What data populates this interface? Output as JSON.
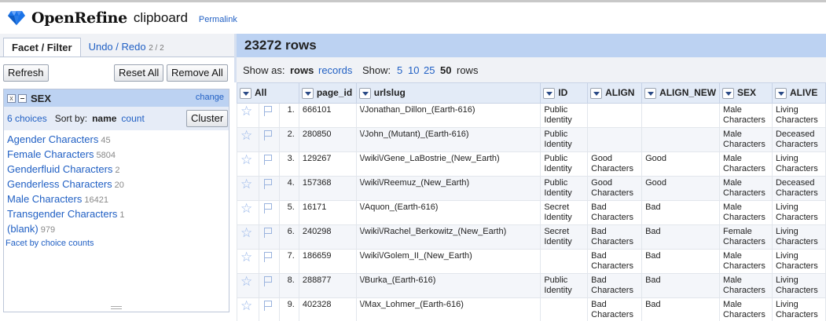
{
  "app": {
    "brand": "OpenRefine",
    "project_name": "clipboard",
    "permalink_label": "Permalink"
  },
  "left_panel": {
    "tabs": [
      {
        "label": "Facet / Filter",
        "sub": ""
      },
      {
        "label": "Undo / Redo",
        "sub": "2 / 2"
      }
    ],
    "refresh_label": "Refresh",
    "reset_all_label": "Reset All",
    "remove_all_label": "Remove All"
  },
  "facet": {
    "remove_glyph": "x",
    "name": "SEX",
    "change_label": "change",
    "choices_label": "6 choices",
    "sort_by_label": "Sort by:",
    "sort_name_label": "name",
    "sort_count_label": "count",
    "cluster_label": "Cluster",
    "choices": [
      {
        "label": "Agender Characters",
        "count": "45"
      },
      {
        "label": "Female Characters",
        "count": "5804"
      },
      {
        "label": "Genderfluid Characters",
        "count": "2"
      },
      {
        "label": "Genderless Characters",
        "count": "20"
      },
      {
        "label": "Male Characters",
        "count": "16421"
      },
      {
        "label": "Transgender Characters",
        "count": "1"
      },
      {
        "label": "(blank)",
        "count": "979"
      }
    ],
    "footer_link": "Facet by choice counts"
  },
  "main": {
    "row_count_title": "23272 rows",
    "show_as_label": "Show as:",
    "show_as_rows": "rows",
    "show_as_records": "records",
    "show_label": "Show:",
    "page_sizes": [
      "5",
      "10",
      "25",
      "50"
    ],
    "selected_page_size": "50",
    "rows_word": "rows"
  },
  "table": {
    "columns": [
      {
        "key": "all",
        "label": "All"
      },
      {
        "key": "page_id",
        "label": "page_id"
      },
      {
        "key": "urlslug",
        "label": "urlslug"
      },
      {
        "key": "ID",
        "label": "ID"
      },
      {
        "key": "ALIGN",
        "label": "ALIGN"
      },
      {
        "key": "ALIGN_NEW",
        "label": "ALIGN_NEW"
      },
      {
        "key": "SEX",
        "label": "SEX"
      },
      {
        "key": "ALIVE",
        "label": "ALIVE"
      }
    ],
    "rows": [
      {
        "n": "1.",
        "page_id": "666101",
        "urlslug": "\\/Jonathan_Dillon_(Earth-616)",
        "id1": "Public",
        "id2": "Identity",
        "al1": "",
        "al2": "",
        "aln": "",
        "sx1": "Male",
        "sx2": "Characters",
        "lv1": "Living",
        "lv2": "Characters"
      },
      {
        "n": "2.",
        "page_id": "280850",
        "urlslug": "\\/John_(Mutant)_(Earth-616)",
        "id1": "Public",
        "id2": "Identity",
        "al1": "",
        "al2": "",
        "aln": "",
        "sx1": "Male",
        "sx2": "Characters",
        "lv1": "Deceased",
        "lv2": "Characters"
      },
      {
        "n": "3.",
        "page_id": "129267",
        "urlslug": "\\/wiki\\/Gene_LaBostrie_(New_Earth)",
        "id1": "Public",
        "id2": "Identity",
        "al1": "Good",
        "al2": "Characters",
        "aln": "Good",
        "sx1": "Male",
        "sx2": "Characters",
        "lv1": "Living",
        "lv2": "Characters"
      },
      {
        "n": "4.",
        "page_id": "157368",
        "urlslug": "\\/wiki\\/Reemuz_(New_Earth)",
        "id1": "Public",
        "id2": "Identity",
        "al1": "Good",
        "al2": "Characters",
        "aln": "Good",
        "sx1": "Male",
        "sx2": "Characters",
        "lv1": "Deceased",
        "lv2": "Characters"
      },
      {
        "n": "5.",
        "page_id": "16171",
        "urlslug": "\\/Aquon_(Earth-616)",
        "id1": "Secret",
        "id2": "Identity",
        "al1": "Bad",
        "al2": "Characters",
        "aln": "Bad",
        "sx1": "Male",
        "sx2": "Characters",
        "lv1": "Living",
        "lv2": "Characters"
      },
      {
        "n": "6.",
        "page_id": "240298",
        "urlslug": "\\/wiki\\/Rachel_Berkowitz_(New_Earth)",
        "id1": "Secret",
        "id2": "Identity",
        "al1": "Bad",
        "al2": "Characters",
        "aln": "Bad",
        "sx1": "Female",
        "sx2": "Characters",
        "lv1": "Living",
        "lv2": "Characters"
      },
      {
        "n": "7.",
        "page_id": "186659",
        "urlslug": "\\/wiki\\/Golem_II_(New_Earth)",
        "id1": "",
        "id2": "",
        "al1": "Bad",
        "al2": "Characters",
        "aln": "Bad",
        "sx1": "Male",
        "sx2": "Characters",
        "lv1": "Living",
        "lv2": "Characters"
      },
      {
        "n": "8.",
        "page_id": "288877",
        "urlslug": "\\/Burka_(Earth-616)",
        "id1": "Public",
        "id2": "Identity",
        "al1": "Bad",
        "al2": "Characters",
        "aln": "Bad",
        "sx1": "Male",
        "sx2": "Characters",
        "lv1": "Living",
        "lv2": "Characters"
      },
      {
        "n": "9.",
        "page_id": "402328",
        "urlslug": "\\/Max_Lohmer_(Earth-616)",
        "id1": "",
        "id2": "",
        "al1": "Bad",
        "al2": "Characters",
        "aln": "Bad",
        "sx1": "Male",
        "sx2": "Characters",
        "lv1": "Living",
        "lv2": "Characters"
      }
    ]
  },
  "icons": {
    "logo": "diamond-logo-icon",
    "star": "star-icon",
    "flag": "flag-icon",
    "dropdown": "chevron-down-icon"
  },
  "colors": {
    "link": "#2160c4",
    "header_band": "#bcd2f2",
    "logo_blue": "#1a73e8"
  }
}
